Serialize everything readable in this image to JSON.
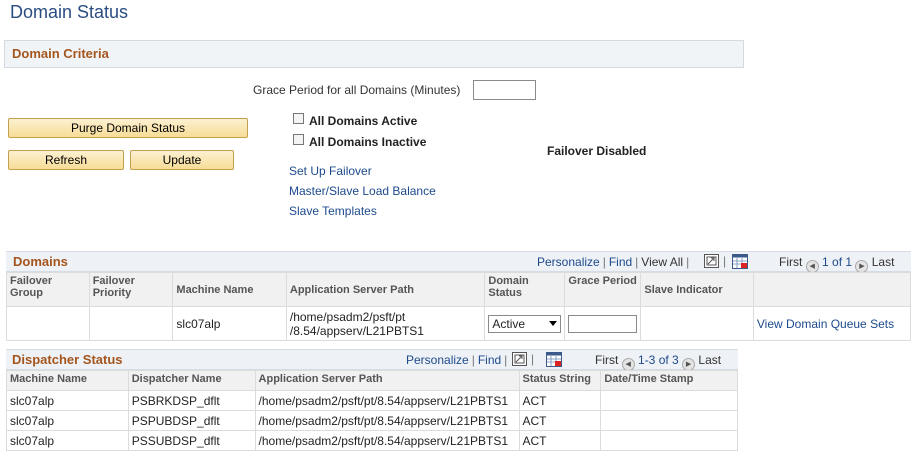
{
  "page": {
    "title": "Domain Status"
  },
  "criteria": {
    "section_title": "Domain Criteria",
    "grace_period_label": "Grace Period for all Domains (Minutes)",
    "grace_period_value": "",
    "purge_button": "Purge Domain Status",
    "refresh_button": "Refresh",
    "update_button": "Update",
    "all_active_label": "All Domains Active",
    "all_inactive_label": "All Domains Inactive",
    "failover_status": "Failover Disabled",
    "links": [
      "Set Up Failover",
      "Master/Slave Load Balance",
      "Slave Templates"
    ]
  },
  "domains": {
    "title": "Domains",
    "nav": {
      "personalize": "Personalize",
      "find": "Find",
      "view_all": "View All",
      "first": "First",
      "range": "1 of 1",
      "last": "Last"
    },
    "columns": [
      "Failover Group",
      "Failover Priority",
      "Machine Name",
      "Application Server Path",
      "Domain Status",
      "Grace Period",
      "Slave Indicator"
    ],
    "rows": [
      {
        "failover_group": "",
        "failover_priority": "",
        "machine_name": "slc07alp",
        "app_server_path": "/home/psadm2/psft/pt /8.54/appserv/L21PBTS1",
        "domain_status": "Active",
        "grace_period": "",
        "slave_indicator": "",
        "link": "View Domain Queue Sets"
      }
    ]
  },
  "dispatcher": {
    "title": "Dispatcher Status",
    "nav": {
      "personalize": "Personalize",
      "find": "Find",
      "first": "First",
      "range": "1-3 of 3",
      "last": "Last"
    },
    "columns": [
      "Machine Name",
      "Dispatcher Name",
      "Application Server Path",
      "Status String",
      "Date/Time Stamp"
    ],
    "rows": [
      {
        "machine_name": "slc07alp",
        "dispatcher_name": "PSBRKDSP_dflt",
        "app_server_path": "/home/psadm2/psft/pt/8.54/appserv/L21PBTS1",
        "status": "ACT",
        "timestamp": ""
      },
      {
        "machine_name": "slc07alp",
        "dispatcher_name": "PSPUBDSP_dflt",
        "app_server_path": "/home/psadm2/psft/pt/8.54/appserv/L21PBTS1",
        "status": "ACT",
        "timestamp": ""
      },
      {
        "machine_name": "slc07alp",
        "dispatcher_name": "PSSUBDSP_dflt",
        "app_server_path": "/home/psadm2/psft/pt/8.54/appserv/L21PBTS1",
        "status": "ACT",
        "timestamp": ""
      }
    ]
  },
  "icons": {
    "zoom": "zoom-grid-icon",
    "download": "download-excel-icon",
    "prev": "previous-arrow-icon",
    "next": "next-arrow-icon"
  }
}
